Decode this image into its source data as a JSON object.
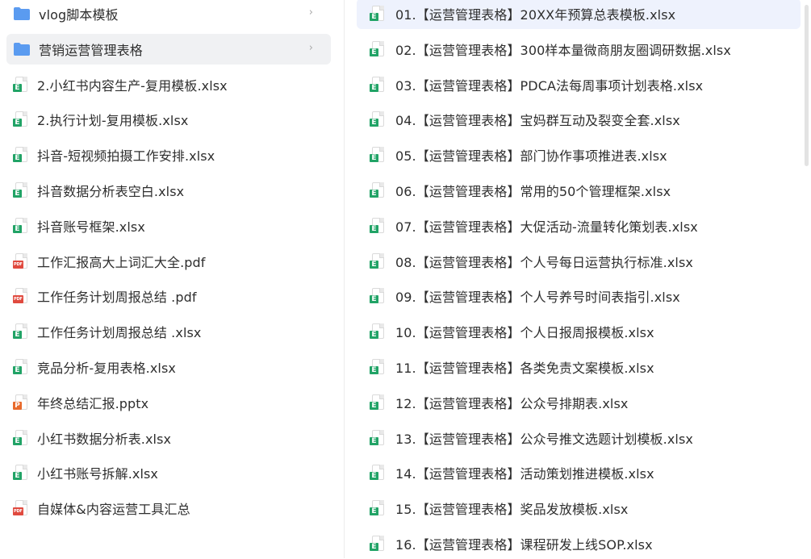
{
  "theme": {
    "folder_color": "#5b9bf0",
    "excel_color": "#21a366",
    "pdf_color": "#e04a3f",
    "ppt_color": "#e86a2c",
    "selected_right_bg": "#eef2fd",
    "selected_left_bg": "#f0f1f3"
  },
  "left_list": [
    {
      "icon": "folder-icon",
      "kind": "folder",
      "label": "vlog脚本模板",
      "chevron": "›",
      "selected": false
    },
    {
      "icon": "folder-icon",
      "kind": "folder",
      "label": "营销运营管理表格",
      "chevron": "›",
      "selected": true
    },
    {
      "icon": "excel-file-icon",
      "kind": "xlsx",
      "badge": "E",
      "label": "2.小红书内容生产-复用模板.xlsx"
    },
    {
      "icon": "excel-file-icon",
      "kind": "xlsx",
      "badge": "E",
      "label": "2.执行计划-复用模板.xlsx"
    },
    {
      "icon": "excel-file-icon",
      "kind": "xlsx",
      "badge": "E",
      "label": "抖音-短视频拍摄工作安排.xlsx"
    },
    {
      "icon": "excel-file-icon",
      "kind": "xlsx",
      "badge": "E",
      "label": "抖音数据分析表空白.xlsx"
    },
    {
      "icon": "excel-file-icon",
      "kind": "xlsx",
      "badge": "E",
      "label": "抖音账号框架.xlsx"
    },
    {
      "icon": "pdf-file-icon",
      "kind": "pdf",
      "badge": "PDF",
      "label": "工作汇报高大上词汇大全.pdf"
    },
    {
      "icon": "pdf-file-icon",
      "kind": "pdf",
      "badge": "PDF",
      "label": "工作任务计划周报总结 .pdf"
    },
    {
      "icon": "excel-file-icon",
      "kind": "xlsx",
      "badge": "E",
      "label": "工作任务计划周报总结 .xlsx"
    },
    {
      "icon": "excel-file-icon",
      "kind": "xlsx",
      "badge": "E",
      "label": "竞品分析-复用表格.xlsx"
    },
    {
      "icon": "ppt-file-icon",
      "kind": "pptx",
      "badge": "P",
      "label": "年终总结汇报.pptx"
    },
    {
      "icon": "excel-file-icon",
      "kind": "xlsx",
      "badge": "E",
      "label": "小红书数据分析表.xlsx"
    },
    {
      "icon": "excel-file-icon",
      "kind": "xlsx",
      "badge": "E",
      "label": "小红书账号拆解.xlsx"
    },
    {
      "icon": "pdf-file-icon",
      "kind": "pdf",
      "badge": "PDF",
      "label": "自媒体&内容运营工具汇总"
    }
  ],
  "right_list": [
    {
      "icon": "excel-file-icon",
      "kind": "xlsx",
      "badge": "E",
      "label": "01.【运营管理表格】20XX年预算总表模板.xlsx",
      "selected": true
    },
    {
      "icon": "excel-file-icon",
      "kind": "xlsx",
      "badge": "E",
      "label": "02.【运营管理表格】300样本量微商朋友圈调研数据.xlsx"
    },
    {
      "icon": "excel-file-icon",
      "kind": "xlsx",
      "badge": "E",
      "label": "03.【运营管理表格】PDCA法每周事项计划表格.xlsx"
    },
    {
      "icon": "excel-file-icon",
      "kind": "xlsx",
      "badge": "E",
      "label": "04.【运营管理表格】宝妈群互动及裂变全套.xlsx"
    },
    {
      "icon": "excel-file-icon",
      "kind": "xlsx",
      "badge": "E",
      "label": "05.【运营管理表格】部门协作事项推进表.xlsx"
    },
    {
      "icon": "excel-file-icon",
      "kind": "xlsx",
      "badge": "E",
      "label": "06.【运营管理表格】常用的50个管理框架.xlsx"
    },
    {
      "icon": "excel-file-icon",
      "kind": "xlsx",
      "badge": "E",
      "label": "07.【运营管理表格】大促活动-流量转化策划表.xlsx"
    },
    {
      "icon": "excel-file-icon",
      "kind": "xlsx",
      "badge": "E",
      "label": "08.【运营管理表格】个人号每日运营执行标准.xlsx"
    },
    {
      "icon": "excel-file-icon",
      "kind": "xlsx",
      "badge": "E",
      "label": "09.【运营管理表格】个人号养号时间表指引.xlsx"
    },
    {
      "icon": "excel-file-icon",
      "kind": "xlsx",
      "badge": "E",
      "label": "10.【运营管理表格】个人日报周报模板.xlsx"
    },
    {
      "icon": "excel-file-icon",
      "kind": "xlsx",
      "badge": "E",
      "label": "11.【运营管理表格】各类免责文案模板.xlsx"
    },
    {
      "icon": "excel-file-icon",
      "kind": "xlsx",
      "badge": "E",
      "label": "12.【运营管理表格】公众号排期表.xlsx"
    },
    {
      "icon": "excel-file-icon",
      "kind": "xlsx",
      "badge": "E",
      "label": "13.【运营管理表格】公众号推文选题计划模板.xlsx"
    },
    {
      "icon": "excel-file-icon",
      "kind": "xlsx",
      "badge": "E",
      "label": "14.【运营管理表格】活动策划推进模板.xlsx"
    },
    {
      "icon": "excel-file-icon",
      "kind": "xlsx",
      "badge": "E",
      "label": "15.【运营管理表格】奖品发放模板.xlsx"
    },
    {
      "icon": "excel-file-icon",
      "kind": "xlsx",
      "badge": "E",
      "label": "16.【运营管理表格】课程研发上线SOP.xlsx"
    }
  ]
}
